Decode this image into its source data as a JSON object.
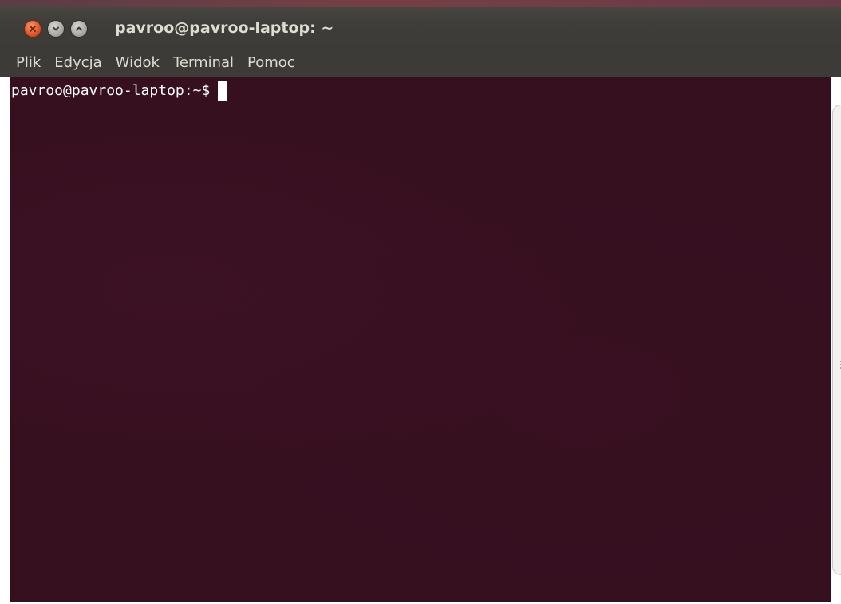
{
  "window": {
    "title": "pavroo@pavroo-laptop: ~",
    "buttons": [
      {
        "name": "close",
        "icon": "close-icon"
      },
      {
        "name": "minimize",
        "icon": "chevron-down-icon"
      },
      {
        "name": "maximize",
        "icon": "chevron-up-icon"
      }
    ]
  },
  "menubar": {
    "items": [
      {
        "label": "Plik"
      },
      {
        "label": "Edycja"
      },
      {
        "label": "Widok"
      },
      {
        "label": "Terminal"
      },
      {
        "label": "Pomoc"
      }
    ]
  },
  "terminal": {
    "prompt": "pavroo@pavroo-laptop:~$",
    "input": ""
  },
  "colors": {
    "titlebar": "#3c3b37",
    "title_text": "#dfdbd2",
    "terminal_bg": "#36101f",
    "terminal_fg": "#ffffff",
    "close_button": "#e2572b"
  }
}
